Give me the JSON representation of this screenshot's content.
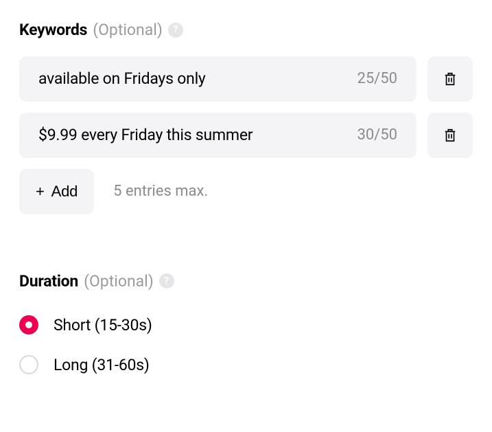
{
  "keywords": {
    "title": "Keywords",
    "optional": "(Optional)",
    "entries": [
      {
        "text": "available on Fridays only",
        "count": "25/50"
      },
      {
        "text": "$9.99 every Friday this summer",
        "count": "30/50"
      }
    ],
    "add_label": "Add",
    "note": "5 entries max."
  },
  "duration": {
    "title": "Duration",
    "optional": "(Optional)",
    "options": [
      {
        "label": "Short (15-30s)",
        "selected": true
      },
      {
        "label": "Long (31-60s)",
        "selected": false
      }
    ]
  }
}
